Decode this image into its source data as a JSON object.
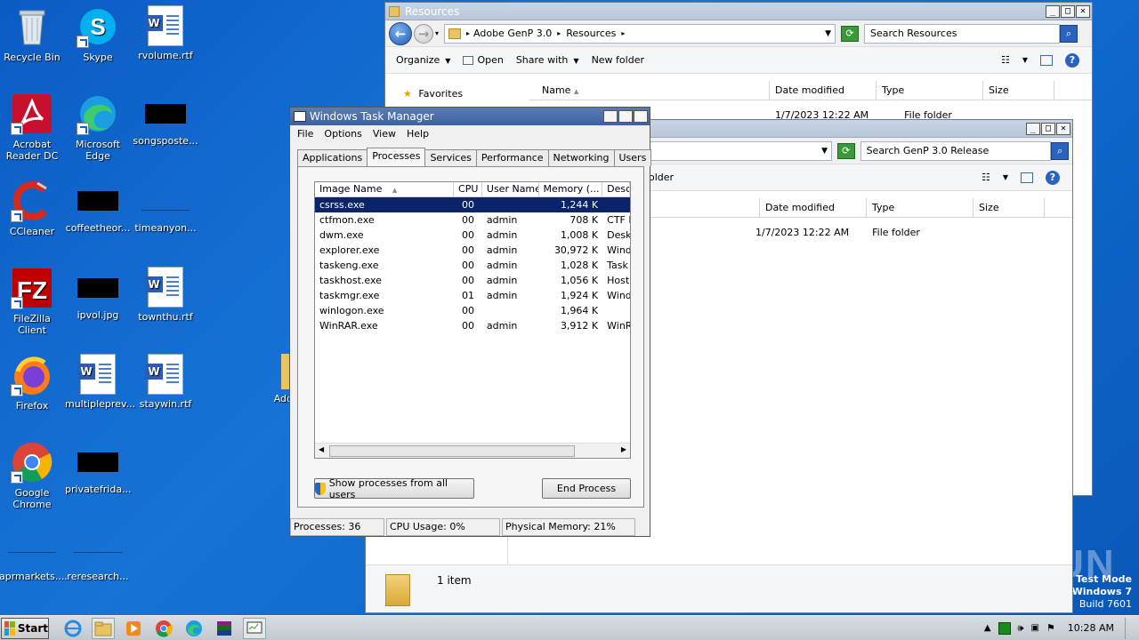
{
  "desktop": {
    "icons": [
      {
        "label": "Recycle Bin"
      },
      {
        "label": "Skype"
      },
      {
        "label": "rvolume.rtf"
      },
      {
        "label": "Acrobat Reader DC"
      },
      {
        "label": "Microsoft Edge"
      },
      {
        "label": "songsposte..."
      },
      {
        "label": "CCleaner"
      },
      {
        "label": "coffeetheor..."
      },
      {
        "label": "timeanyon..."
      },
      {
        "label": "FileZilla Client"
      },
      {
        "label": "ipvol.jpg"
      },
      {
        "label": "townthu.rtf"
      },
      {
        "label": "Firefox"
      },
      {
        "label": "multipleprev..."
      },
      {
        "label": "staywin.rtf"
      },
      {
        "label": "Google Chrome"
      },
      {
        "label": "privatefrida..."
      },
      {
        "label": "aprmarkets...."
      },
      {
        "label": "reresearch..."
      },
      {
        "label": "Add"
      }
    ]
  },
  "explorer1": {
    "title": "Resources",
    "breadcrumb": [
      "Adobe GenP 3.0",
      "Resources"
    ],
    "search_placeholder": "Search Resources",
    "commands": [
      "Organize",
      "Open",
      "Share with",
      "New folder"
    ],
    "nav_favorites": "Favorites",
    "columns": [
      "Name",
      "Date modified",
      "Type",
      "Size"
    ],
    "row": {
      "date": "1/7/2023 12:22 AM",
      "type": "File folder"
    }
  },
  "explorer2": {
    "search_placeholder": "Search GenP 3.0 Release",
    "command_partial": "older",
    "columns": [
      "Date modified",
      "Type",
      "Size"
    ],
    "row": {
      "date": "1/7/2023 12:22 AM",
      "type": "File folder"
    },
    "status_count": "1 item"
  },
  "taskmgr": {
    "title": "Windows Task Manager",
    "menu": [
      "File",
      "Options",
      "View",
      "Help"
    ],
    "tabs": [
      "Applications",
      "Processes",
      "Services",
      "Performance",
      "Networking",
      "Users"
    ],
    "active_tab": "Processes",
    "columns": [
      "Image Name",
      "CPU",
      "User Name",
      "Memory (...",
      "Desc"
    ],
    "processes": [
      {
        "name": "csrss.exe",
        "cpu": "00",
        "user": "",
        "mem": "1,244 K",
        "desc": ""
      },
      {
        "name": "ctfmon.exe",
        "cpu": "00",
        "user": "admin",
        "mem": "708 K",
        "desc": "CTF I"
      },
      {
        "name": "dwm.exe",
        "cpu": "00",
        "user": "admin",
        "mem": "1,008 K",
        "desc": "Desk"
      },
      {
        "name": "explorer.exe",
        "cpu": "00",
        "user": "admin",
        "mem": "30,972 K",
        "desc": "Wind"
      },
      {
        "name": "taskeng.exe",
        "cpu": "00",
        "user": "admin",
        "mem": "1,028 K",
        "desc": "Task"
      },
      {
        "name": "taskhost.exe",
        "cpu": "00",
        "user": "admin",
        "mem": "1,056 K",
        "desc": "Host"
      },
      {
        "name": "taskmgr.exe",
        "cpu": "01",
        "user": "admin",
        "mem": "1,924 K",
        "desc": "Wind"
      },
      {
        "name": "winlogon.exe",
        "cpu": "00",
        "user": "",
        "mem": "1,964 K",
        "desc": ""
      },
      {
        "name": "WinRAR.exe",
        "cpu": "00",
        "user": "admin",
        "mem": "3,912 K",
        "desc": "WinR"
      }
    ],
    "show_all_label": "Show processes from all users",
    "end_process_label": "End Process",
    "status": {
      "processes": "Processes: 36",
      "cpu": "CPU Usage: 0%",
      "memory": "Physical Memory: 21%"
    }
  },
  "taskbar": {
    "start_label": "Start",
    "clock": "10:28 AM"
  },
  "watermark": {
    "line1": "Test Mode",
    "line2": "Windows 7",
    "line3": "Build 7601",
    "brand": "ANY RUN"
  }
}
